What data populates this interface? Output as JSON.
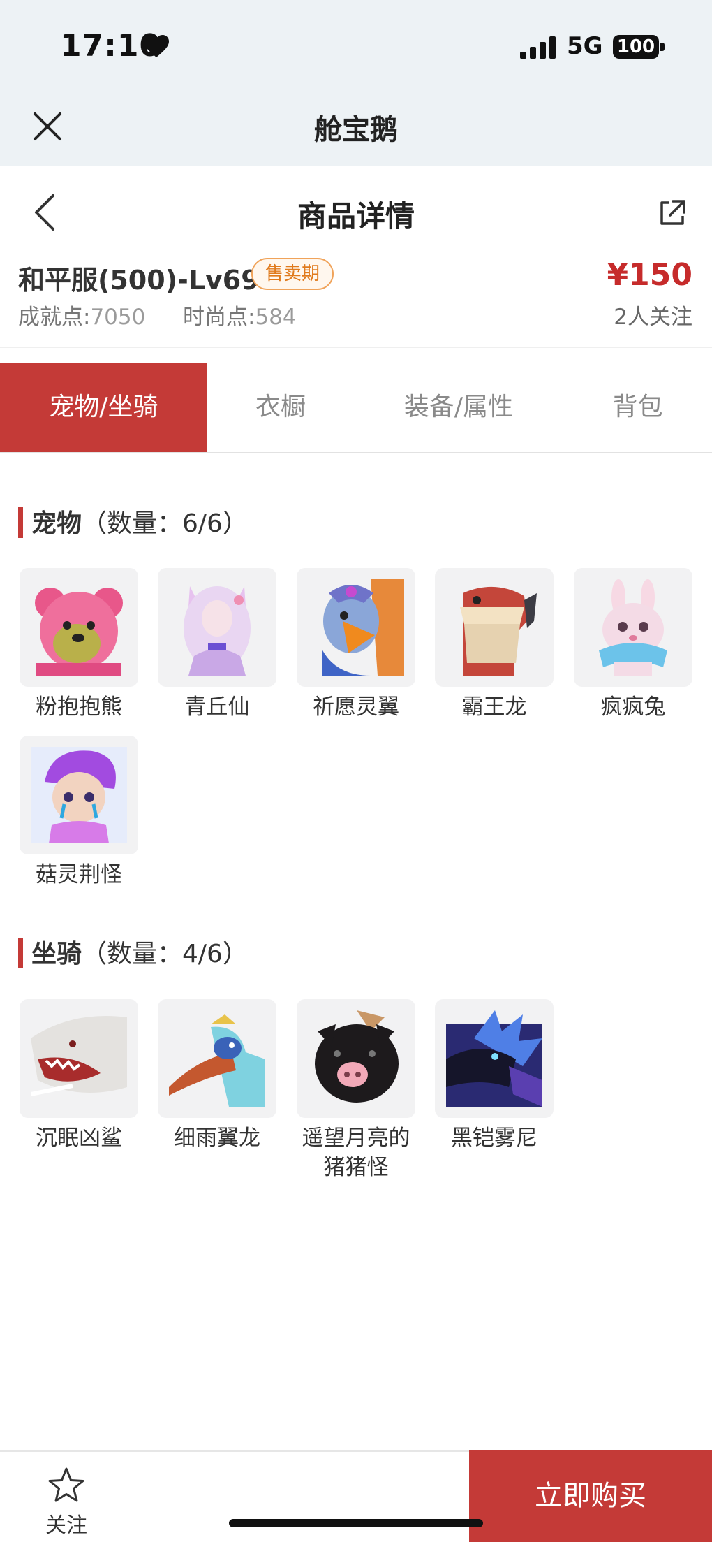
{
  "status_bar": {
    "time": "17:10",
    "network": "5G",
    "battery": "100"
  },
  "app_bar": {
    "title": "舱宝鹅"
  },
  "page_header": {
    "title": "商品详情"
  },
  "product": {
    "title": "和平服(500)-Lv69",
    "badge": "售卖期",
    "price": "¥150",
    "achievement_label": "成就点:",
    "achievement_value": "7050",
    "fashion_label": "时尚点:",
    "fashion_value": "584",
    "followers": "2人关注"
  },
  "tabs": [
    {
      "label": "宠物/坐骑",
      "active": true
    },
    {
      "label": "衣橱",
      "active": false
    },
    {
      "label": "装备/属性",
      "active": false
    },
    {
      "label": "背包",
      "active": false
    }
  ],
  "pets": {
    "heading": "宠物",
    "count": "（数量：6/6）",
    "items": [
      {
        "name": "粉抱抱熊",
        "icon": "pink-bear-icon"
      },
      {
        "name": "青丘仙",
        "icon": "fox-fairy-icon"
      },
      {
        "name": "祈愿灵翼",
        "icon": "griffin-icon"
      },
      {
        "name": "霸王龙",
        "icon": "trex-icon"
      },
      {
        "name": "疯疯兔",
        "icon": "rabbit-icon"
      },
      {
        "name": "菇灵荆怪",
        "icon": "mushroom-spirit-icon"
      }
    ]
  },
  "mounts": {
    "heading": "坐骑",
    "count": "（数量：4/6）",
    "items": [
      {
        "name": "沉眠凶鲨",
        "icon": "shark-icon"
      },
      {
        "name": "细雨翼龙",
        "icon": "pterosaur-icon"
      },
      {
        "name": "遥望月亮的猪猪怪",
        "name_line1": "遥望月亮的",
        "name_line2": "猪猪怪",
        "icon": "pig-icon"
      },
      {
        "name": "黑铠雾尼",
        "icon": "dark-dragon-icon"
      }
    ]
  },
  "bottom_bar": {
    "follow_label": "关注",
    "buy_label": "立即购买"
  },
  "colors": {
    "accent": "#c43a37",
    "badge": "#e07a1c",
    "price": "#c62b2b"
  }
}
